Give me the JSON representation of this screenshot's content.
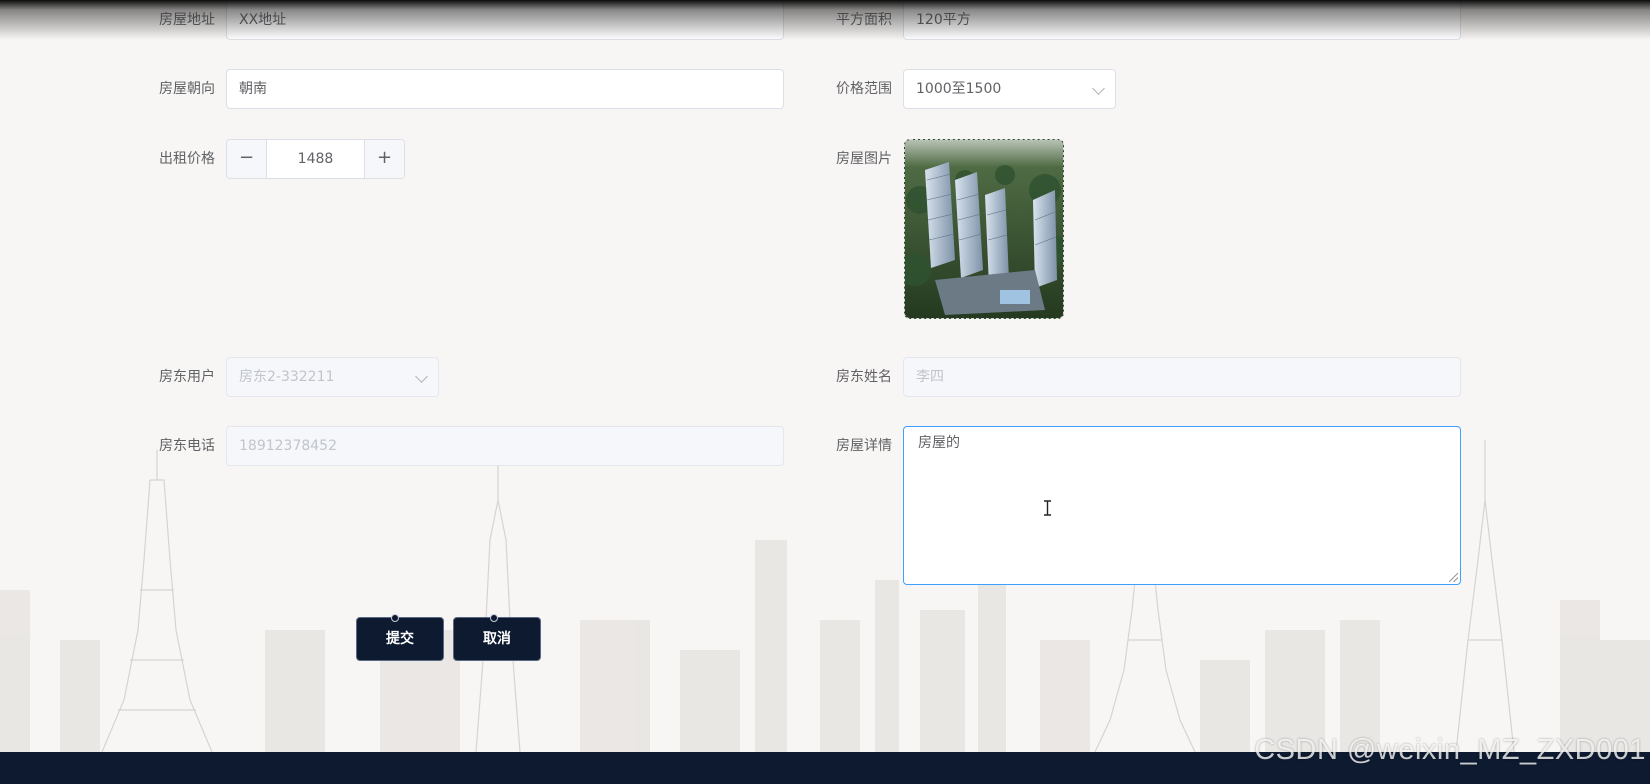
{
  "form": {
    "address": {
      "label": "房屋地址",
      "value": "XX地址"
    },
    "area": {
      "label": "平方面积",
      "value": "120平方"
    },
    "orientation": {
      "label": "房屋朝向",
      "value": "朝南"
    },
    "price_range": {
      "label": "价格范围",
      "value": "1000至1500"
    },
    "rent_price": {
      "label": "出租价格",
      "value": "1488",
      "minus": "−",
      "plus": "+"
    },
    "house_image": {
      "label": "房屋图片"
    },
    "landlord_user": {
      "label": "房东用户",
      "value": "房东2-332211"
    },
    "landlord_name": {
      "label": "房东姓名",
      "value": "李四"
    },
    "landlord_phone": {
      "label": "房东电话",
      "value": "18912378452"
    },
    "house_detail": {
      "label": "房屋详情",
      "value": "房屋的"
    }
  },
  "actions": {
    "submit": "提交",
    "cancel": "取消"
  },
  "watermark": "CSDN @weixin_MZ_ZXD001",
  "colors": {
    "navy": "#0d1a30",
    "focus_border": "#409eff",
    "border": "#dcdfe6",
    "disabled_bg": "#f5f7fa"
  },
  "icons": [
    "chevron-down-icon",
    "minus-icon",
    "plus-icon",
    "text-cursor-icon",
    "resize-grip-icon"
  ]
}
